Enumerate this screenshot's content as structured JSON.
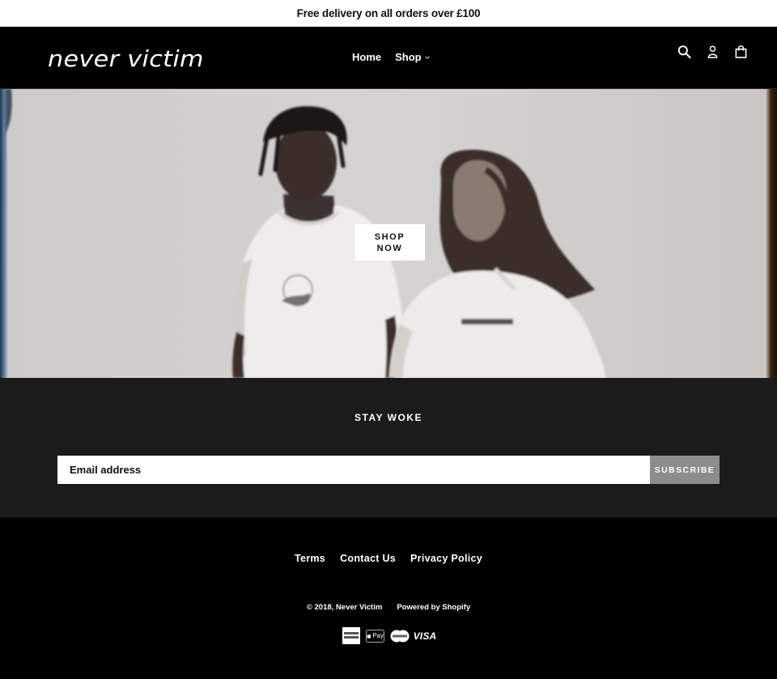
{
  "announcement": {
    "text": "Free delivery on all orders over £100"
  },
  "header": {
    "logo_text": "never victim",
    "nav": [
      {
        "label": "Home",
        "has_dropdown": false
      },
      {
        "label": "Shop",
        "has_dropdown": true
      }
    ],
    "icons": [
      {
        "name": "search-icon",
        "label": "Search"
      },
      {
        "name": "account-icon",
        "label": "Log in"
      },
      {
        "name": "cart-icon",
        "label": "Cart"
      }
    ]
  },
  "hero": {
    "button_label": "SHOP NOW",
    "image_alt": "Two models wearing white Never Victim t-shirt and hoodie"
  },
  "newsletter": {
    "heading": "STAY WOKE",
    "email_placeholder": "Email address",
    "email_value": "",
    "subscribe_label": "SUBSCRIBE"
  },
  "footer": {
    "links": [
      {
        "label": "Terms"
      },
      {
        "label": "Contact Us"
      },
      {
        "label": "Privacy Policy"
      }
    ],
    "copyright": "© 2018, Never Victim",
    "powered_by": "Powered by Shopify",
    "payment_methods": [
      {
        "name": "amex",
        "label": "American Express"
      },
      {
        "name": "apple-pay",
        "label": "Pay"
      },
      {
        "name": "mastercard",
        "label": "Mastercard"
      },
      {
        "name": "visa",
        "label": "VISA"
      }
    ]
  },
  "colors": {
    "announcement_bg": "#ffffff",
    "header_bg": "#000000",
    "newsletter_bg": "#1b1b1b",
    "subscribe_button_bg": "#8c8c8c",
    "footer_bg": "#000000"
  }
}
